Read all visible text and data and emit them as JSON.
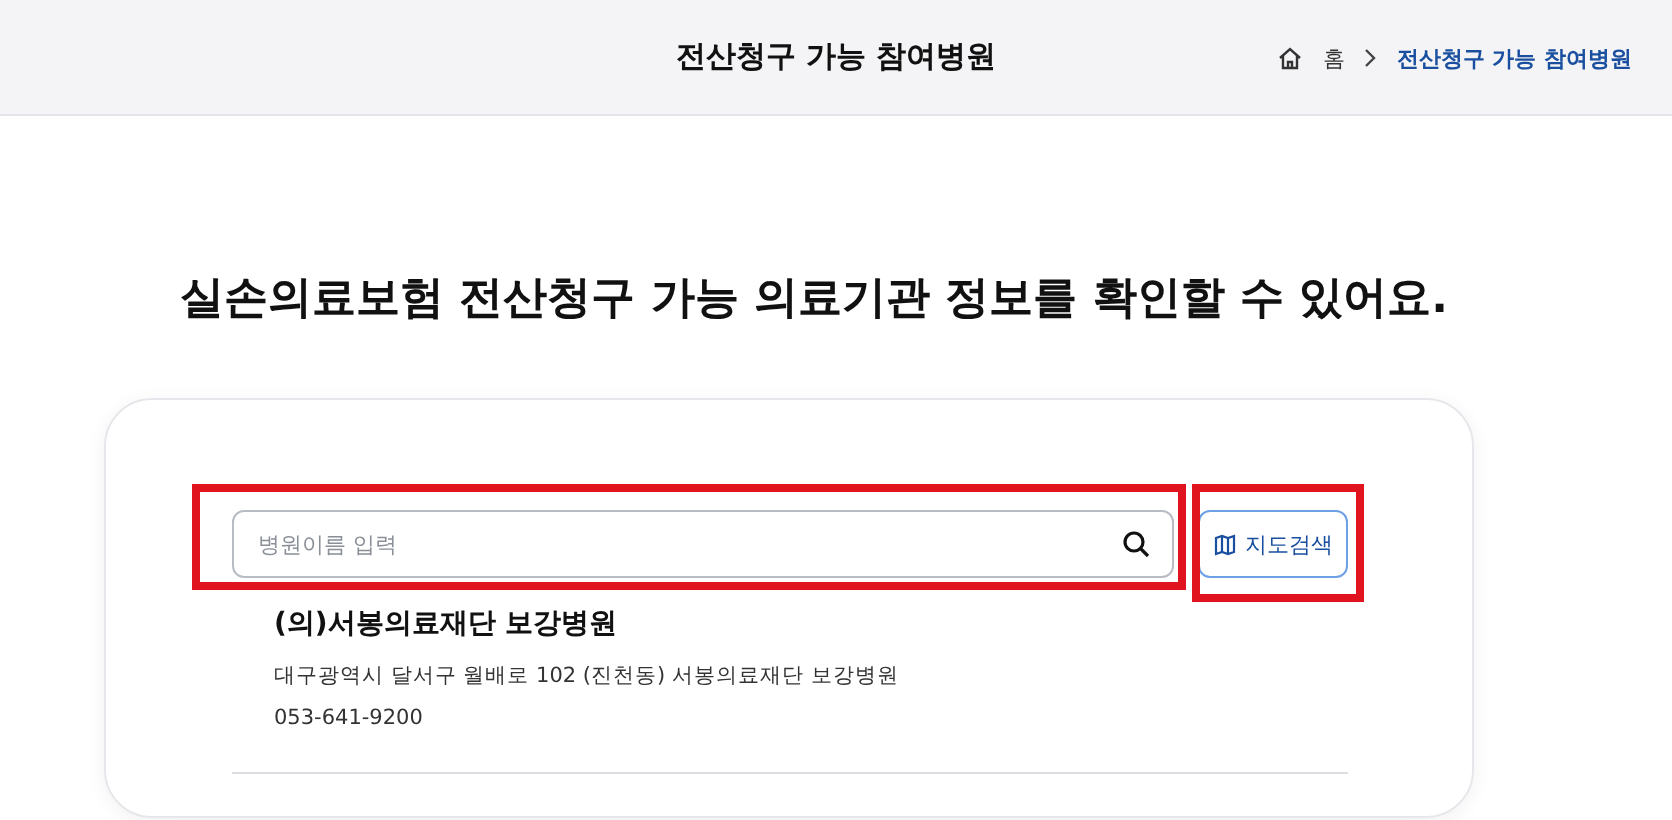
{
  "header": {
    "title": "전산청구 가능 참여병원",
    "breadcrumb": [
      {
        "label": "홈",
        "selected": false
      },
      {
        "label": "전산청구 가능 참여병원",
        "selected": true
      }
    ]
  },
  "headline": "실손의료보험 전산청구 가능 의료기관 정보를 확인할 수 있어요.",
  "search": {
    "placeholder": "병원이름 입력",
    "highlighted": true
  },
  "map_button": {
    "label": "지도검색",
    "highlighted": true
  },
  "results": [
    {
      "name": "(의)서봉의료재단 보강병원",
      "address": "대구광역시 달서구 월배로 102 (진천동) 서봉의료재단 보강병원",
      "phone": "053-641-9200"
    }
  ]
}
